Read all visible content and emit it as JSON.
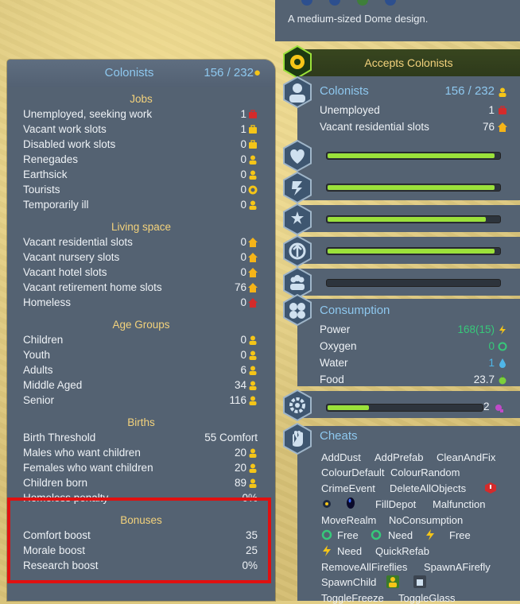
{
  "building": {
    "description": "A medium-sized Dome design."
  },
  "left_panel": {
    "title": "Colonists",
    "count": "156 / 232",
    "jobs": {
      "header": "Jobs",
      "rows": [
        {
          "label": "Unemployed, seeking work",
          "value": "1",
          "icon": "briefcase-red-icon"
        },
        {
          "label": "Vacant work slots",
          "value": "1",
          "icon": "briefcase-icon"
        },
        {
          "label": "Disabled work slots",
          "value": "0",
          "icon": "briefcase-icon"
        },
        {
          "label": "Renegades",
          "value": "0",
          "icon": "colonist-icon"
        },
        {
          "label": "Earthsick",
          "value": "0",
          "icon": "colonist-icon"
        },
        {
          "label": "Tourists",
          "value": "0",
          "icon": "tourist-icon"
        },
        {
          "label": "Temporarily ill",
          "value": "0",
          "icon": "colonist-icon"
        }
      ]
    },
    "living": {
      "header": "Living space",
      "rows": [
        {
          "label": "Vacant residential slots",
          "value": "0",
          "icon": "home-icon"
        },
        {
          "label": "Vacant nursery slots",
          "value": "0",
          "icon": "home-icon"
        },
        {
          "label": "Vacant hotel slots",
          "value": "0",
          "icon": "home-icon"
        },
        {
          "label": "Vacant retirement home slots",
          "value": "76",
          "icon": "home-icon"
        },
        {
          "label": "Homeless",
          "value": "0",
          "icon": "home-red-icon"
        }
      ]
    },
    "ages": {
      "header": "Age Groups",
      "rows": [
        {
          "label": "Children",
          "value": "0",
          "icon": "colonist-icon"
        },
        {
          "label": "Youth",
          "value": "0",
          "icon": "colonist-icon"
        },
        {
          "label": "Adults",
          "value": "6",
          "icon": "colonist-icon"
        },
        {
          "label": "Middle Aged",
          "value": "34",
          "icon": "colonist-icon"
        },
        {
          "label": "Senior",
          "value": "116",
          "icon": "colonist-icon"
        }
      ]
    },
    "births": {
      "header": "Births",
      "rows": [
        {
          "label": "Birth Threshold",
          "value": "55 Comfort"
        },
        {
          "label": "Males who want children",
          "value": "20",
          "icon": "colonist-icon"
        },
        {
          "label": "Females who want children",
          "value": "20",
          "icon": "colonist-icon"
        },
        {
          "label": "Children born",
          "value": "89",
          "icon": "colonist-icon"
        },
        {
          "label": "Homeless penalty",
          "value": "0%"
        }
      ]
    },
    "bonuses": {
      "header": "Bonuses",
      "rows": [
        {
          "label": "Comfort boost",
          "value": "35"
        },
        {
          "label": "Morale boost",
          "value": "25"
        },
        {
          "label": "Research boost",
          "value": "0%"
        }
      ]
    }
  },
  "right_panel": {
    "status": "Accepts Colonists",
    "colonists": {
      "title": "Colonists",
      "count": "156 / 232",
      "unemployed_label": "Unemployed",
      "unemployed_value": "1",
      "vacant_label": "Vacant residential slots",
      "vacant_value": "76"
    },
    "stat_bars": [
      {
        "icon": "health-heart-icon",
        "fill": 0.98
      },
      {
        "icon": "sanity-brain-icon",
        "fill": 0.98
      },
      {
        "icon": "comfort-stars-icon",
        "fill": 0.93
      },
      {
        "icon": "morale-icon",
        "fill": 0.98
      },
      {
        "icon": "social-icon",
        "fill": 0.0
      }
    ],
    "consumption": {
      "title": "Consumption",
      "rows": [
        {
          "label": "Power",
          "value": "168(15)",
          "icon": "power-icon",
          "color": "#37c87a"
        },
        {
          "label": "Oxygen",
          "value": "0",
          "icon": "oxygen-icon",
          "color": "#37c87a"
        },
        {
          "label": "Water",
          "value": "1",
          "icon": "water-icon",
          "color": "#4fb6e8"
        },
        {
          "label": "Food",
          "value": "23.7",
          "icon": "food-icon",
          "color": "#eef2f6"
        }
      ]
    },
    "service": {
      "value": "2",
      "fill": 0.27
    },
    "cheats": {
      "title": "Cheats",
      "items": [
        "AddDust",
        "AddPrefab",
        "CleanAndFix",
        "ColourDefault",
        "ColourRandom",
        "CrimeEvent",
        "DeleteAllObjects",
        "FillDepot",
        "Malfunction",
        "MoveRealm",
        "NoConsumption",
        "Free",
        "Need",
        "Free",
        "Need",
        "QuickRefab",
        "RemoveAllFireflies",
        "SpawnAFirefly",
        "SpawnChild",
        "ToggleFreeze",
        "ToggleGlass"
      ]
    }
  },
  "colors": {
    "panel": "#546272",
    "accent_blue": "#8ec8ef",
    "section_gold": "#f3d27c",
    "bar_green": "#9be13a",
    "highlight": "#e01010"
  }
}
